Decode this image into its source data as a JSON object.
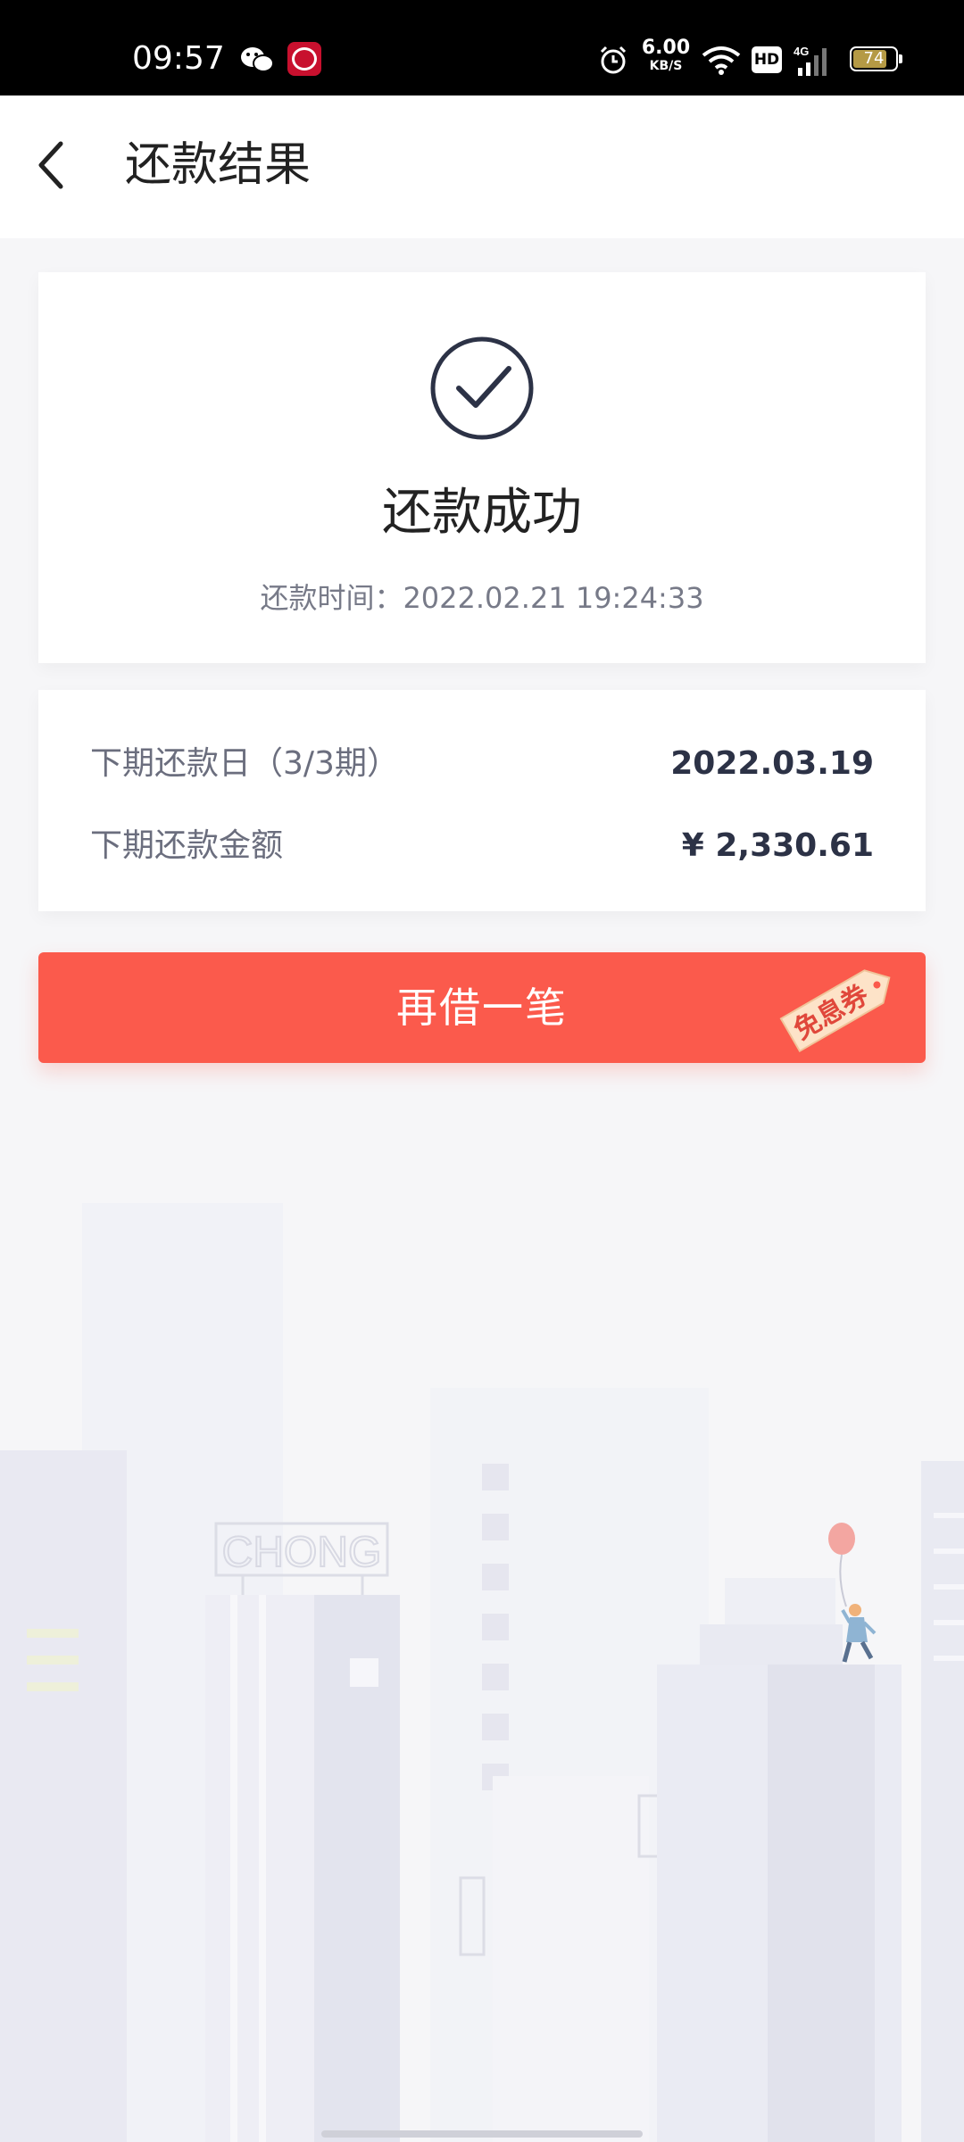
{
  "status_bar": {
    "time": "09:57",
    "net_speed_value": "6.00",
    "net_speed_unit": "KB/S",
    "hd_label": "HD",
    "network_type": "4G",
    "battery": "74",
    "icons": [
      "wechat-icon",
      "cmb-bank-icon",
      "alarm-icon",
      "wifi-icon",
      "signal-icon",
      "battery-icon"
    ]
  },
  "header": {
    "title": "还款结果"
  },
  "result": {
    "status": "还款成功",
    "time_text": "还款时间：2022.02.21 19:24:33"
  },
  "next_payment": {
    "date_label": "下期还款日（3/3期）",
    "date_value": "2022.03.19",
    "amount_label": "下期还款金额",
    "amount_value": "¥ 2,330.61"
  },
  "cta": {
    "label": "再借一笔",
    "coupon_tag": "免息券",
    "color": "#fb5a4c"
  },
  "illustration": {
    "sign_text": "CHONG"
  }
}
